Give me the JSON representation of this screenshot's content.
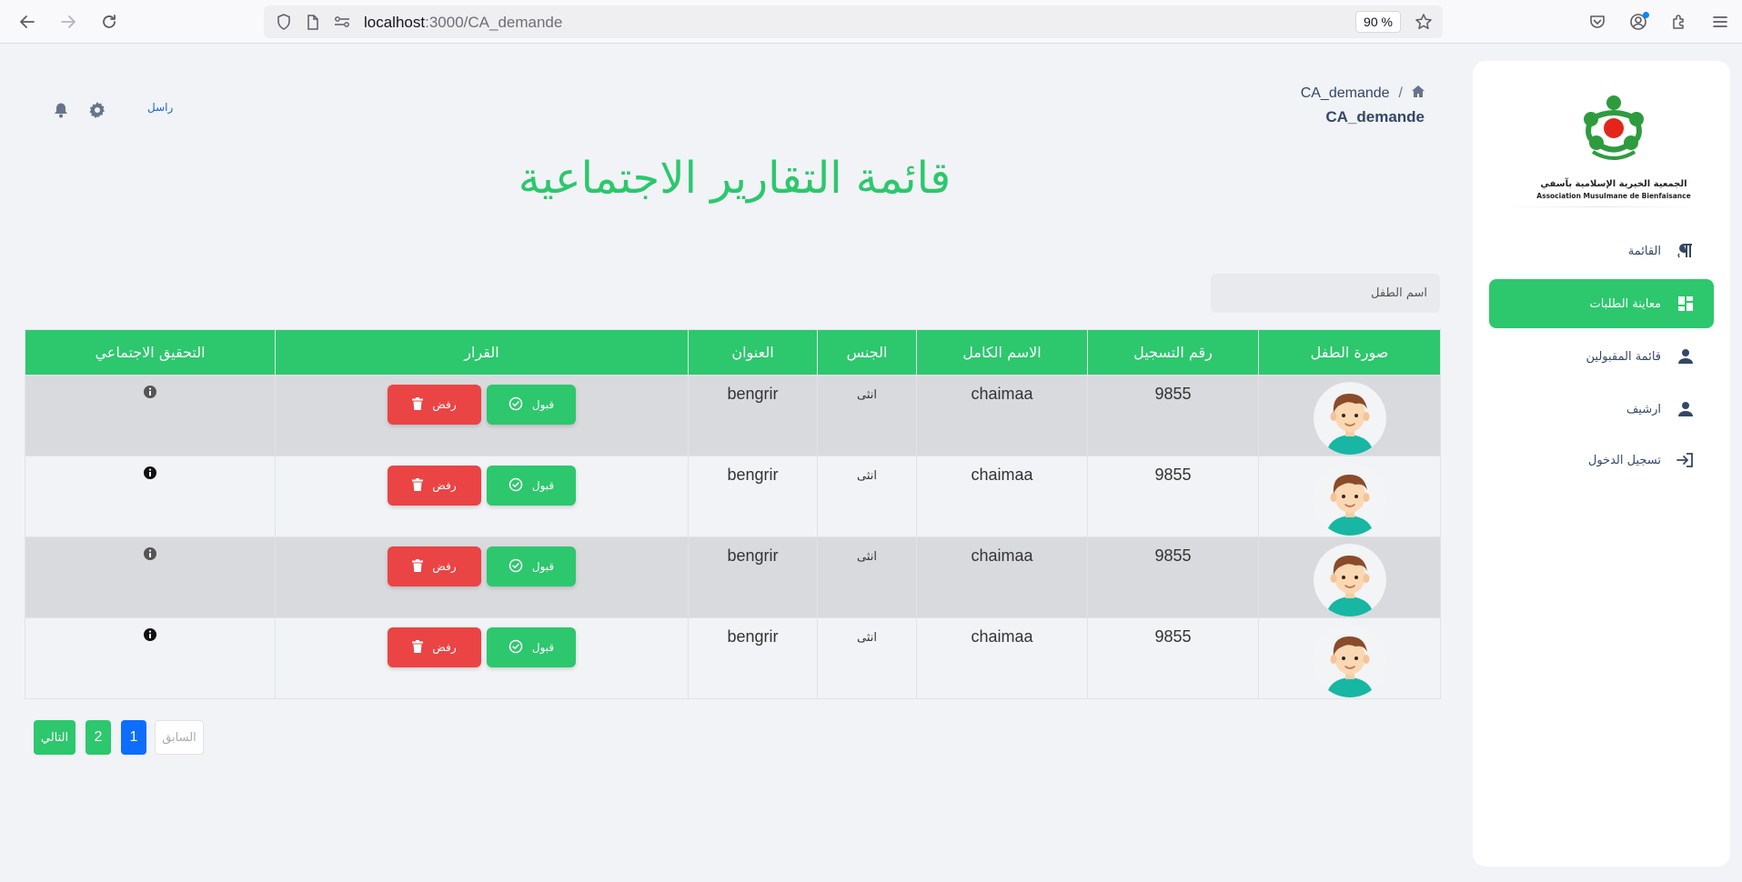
{
  "browser": {
    "url_host": "localhost",
    "url_path": ":3000/CA_demande",
    "zoom": "90 %"
  },
  "sidebar": {
    "logo_text_ar": "الجمعية الخيرية الإسلامية بآسفي",
    "logo_text_fr": "Association Musulmane de Bienfaisance",
    "items": [
      {
        "label": "القائمة",
        "icon": "paragraph-icon",
        "active": false
      },
      {
        "label": "معاينة الطلبات",
        "icon": "dashboard-icon",
        "active": true
      },
      {
        "label": "قائمة المقبولين",
        "icon": "user-icon",
        "active": false
      },
      {
        "label": "ارشيف",
        "icon": "user-icon",
        "active": false
      },
      {
        "label": "تسجيل الدخول",
        "icon": "login-icon",
        "active": false
      }
    ]
  },
  "header": {
    "breadcrumb_current": "CA_demande",
    "breadcrumb_sep": "/",
    "page_subtitle": "CA_demande",
    "send_link": "راسل"
  },
  "page_title": "قائمة التقارير الاجتماعية",
  "search": {
    "placeholder": "اسم الطفل"
  },
  "table": {
    "headers": [
      "صورة الطفل",
      "رقم التسجيل",
      "الاسم الكامل",
      "الجنس",
      "العنوان",
      "القرار",
      "التحقيق الاجتماعي"
    ],
    "accept_label": "قبول",
    "reject_label": "رفض",
    "rows": [
      {
        "reg": "9855",
        "name": "chaimaa",
        "gender": "انثى",
        "address": "bengrir"
      },
      {
        "reg": "9855",
        "name": "chaimaa",
        "gender": "انثى",
        "address": "bengrir"
      },
      {
        "reg": "9855",
        "name": "chaimaa",
        "gender": "انثى",
        "address": "bengrir"
      },
      {
        "reg": "9855",
        "name": "chaimaa",
        "gender": "انثى",
        "address": "bengrir"
      }
    ]
  },
  "pagination": {
    "next": "التالي",
    "page2": "2",
    "page1": "1",
    "prev": "السابق"
  },
  "colors": {
    "accent": "#2dc76d",
    "danger": "#ea4444",
    "primary": "#0d6efd",
    "title": "#2dc76d"
  }
}
